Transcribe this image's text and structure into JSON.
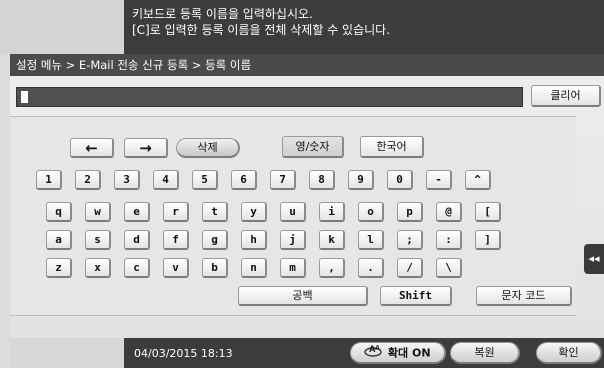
{
  "message": {
    "line1": "키보드로 등록 이름을 입력하십시오.",
    "line2": "[C]로 입력한 등록 이름을 전체 삭제할 수 있습니다."
  },
  "breadcrumb": "설정 메뉴 > E-Mail 전송 신규 등록 > 등록 이름",
  "input": {
    "value": ""
  },
  "buttons": {
    "clear": "클리어",
    "left_arrow": "←",
    "right_arrow": "→",
    "delete": "삭제",
    "mode_en": "영/숫자",
    "mode_ko": "한국어",
    "space": "공백",
    "shift": "Shift",
    "char_code": "문자 코드",
    "zoom": "확대 ON",
    "reset": "복원",
    "ok": "확인"
  },
  "keys": {
    "row1": [
      "1",
      "2",
      "3",
      "4",
      "5",
      "6",
      "7",
      "8",
      "9",
      "0",
      "-",
      "^"
    ],
    "row2": [
      "q",
      "w",
      "e",
      "r",
      "t",
      "y",
      "u",
      "i",
      "o",
      "p",
      "@",
      "["
    ],
    "row3": [
      "a",
      "s",
      "d",
      "f",
      "g",
      "h",
      "j",
      "k",
      "l",
      ";",
      ":",
      "]"
    ],
    "row4": [
      "z",
      "x",
      "c",
      "v",
      "b",
      "n",
      "m",
      ",",
      ".",
      "/",
      "\\"
    ]
  },
  "sidetab": "◂◂",
  "footer": {
    "datetime": "04/03/2015  18:13"
  },
  "icons": [
    "zoom-icon",
    "collapse-icon"
  ]
}
